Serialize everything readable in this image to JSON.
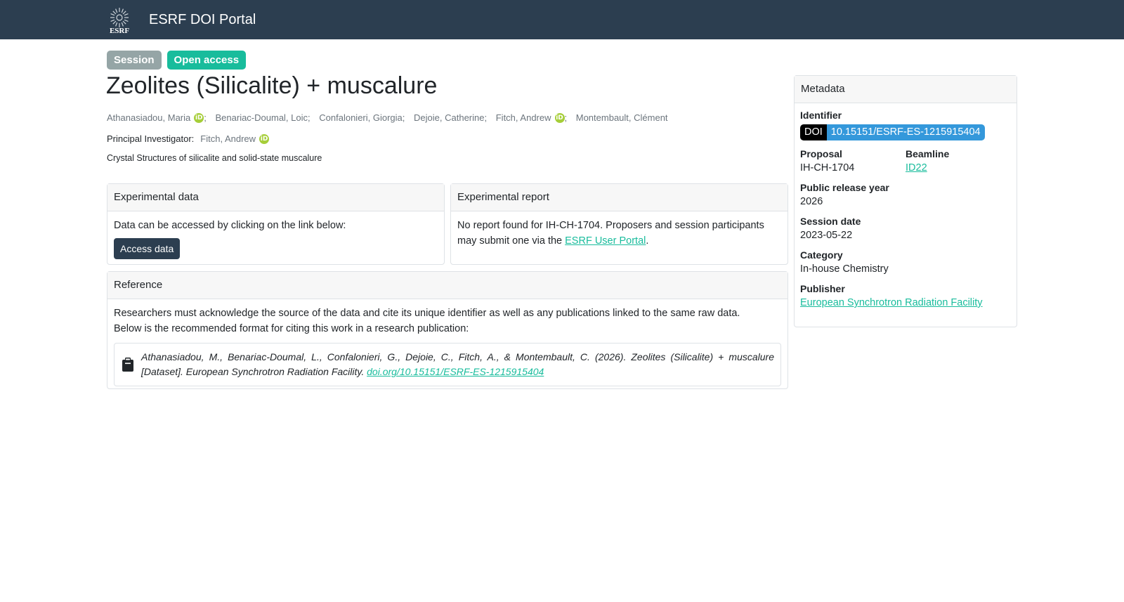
{
  "navbar": {
    "brand": "ESRF DOI Portal",
    "logo_text": "ESRF"
  },
  "badges": {
    "session": "Session",
    "access": "Open access"
  },
  "title": "Zeolites (Silicalite) + muscalure",
  "authors": [
    {
      "name": "Athanasiadou, Maria",
      "orcid": true
    },
    {
      "name": "Benariac-Doumal, Loic",
      "orcid": false
    },
    {
      "name": "Confalonieri, Giorgia",
      "orcid": false
    },
    {
      "name": "Dejoie, Catherine",
      "orcid": false
    },
    {
      "name": "Fitch, Andrew",
      "orcid": true
    },
    {
      "name": "Montembault, Clément",
      "orcid": false
    }
  ],
  "orcid_label": "iD",
  "principal_investigator": {
    "label": "Principal Investigator:",
    "name": "Fitch, Andrew"
  },
  "description": "Crystal Structures of silicalite and solid-state muscalure",
  "experimental_data": {
    "header": "Experimental data",
    "text": "Data can be accessed by clicking on the link below:",
    "button": "Access data"
  },
  "experimental_report": {
    "header": "Experimental report",
    "text_before": "No report found for IH-CH-1704. Proposers and session participants may submit one via the ",
    "link": "ESRF User Portal",
    "text_after": "."
  },
  "reference": {
    "header": "Reference",
    "line1": "Researchers must acknowledge the source of the data and cite its unique identifier as well as any publications linked to the same raw data.",
    "line2": "Below is the recommended format for citing this work in a research publication:",
    "citation": "Athanasiadou, M., Benariac-Doumal, L., Confalonieri, G., Dejoie, C., Fitch, A., & Montembault, C. (2026). Zeolites (Silicalite) + muscalure [Dataset]. European Synchrotron Radiation Facility. ",
    "citation_link": "doi.org/10.15151/ESRF-ES-1215915404"
  },
  "metadata": {
    "header": "Metadata",
    "identifier_label": "Identifier",
    "doi_prefix": "DOI",
    "doi_value": "10.15151/ESRF-ES-1215915404",
    "proposal_label": "Proposal",
    "proposal_value": "IH-CH-1704",
    "beamline_label": "Beamline",
    "beamline_value": "ID22",
    "release_label": "Public release year",
    "release_value": "2026",
    "session_label": "Session date",
    "session_value": "2023-05-22",
    "category_label": "Category",
    "category_value": "In-house Chemistry",
    "publisher_label": "Publisher",
    "publisher_value": "European Synchrotron Radiation Facility"
  },
  "colors": {
    "navbar": "#2c3e50",
    "accent": "#18bc9c",
    "badge_session": "#95a5a6",
    "doi_blue": "#3498db",
    "orcid_green": "#a6ce39"
  }
}
